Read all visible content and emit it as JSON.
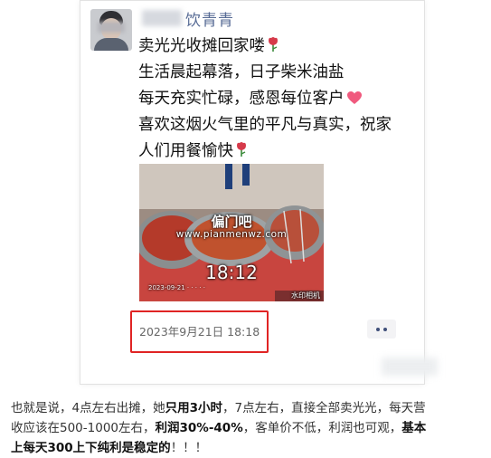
{
  "post": {
    "author_name": "饮青青",
    "lines": [
      "卖光光收摊回家喽",
      "生活晨起幕落，日子柴米油盐",
      "每天充实忙碌，感恩每位客户",
      "喜欢这烟火气里的平凡与真实，祝家",
      "人们用餐愉快"
    ],
    "emoji_icons": [
      "rose-icon",
      "heart-icon",
      "rose-icon"
    ],
    "photo": {
      "watermark_site_cn": "偏门吧",
      "watermark_url": "www.pianmenwz.com",
      "time_overlay": "18:12",
      "camera_label": "水印相机",
      "caption_small": "2023-09-21  ·  ·  ·  ·  ·"
    },
    "timestamp": "2023年9月21日 18:18",
    "more_button_icon": "more-dots-icon"
  },
  "article": {
    "line1_a": "也就是说，4点左右出摊，她",
    "line1_b": "只用3小时",
    "line1_c": "，7点左右，直接全部卖光光，每天营",
    "line2_a": "收应该在500-1000左右，",
    "line2_b": "利润30%-40%",
    "line2_c": "，客单价不低，利润也可观，",
    "line2_d": "基本",
    "line3_a": "上每天300上下纯利是稳定的",
    "line3_b": "！！！"
  },
  "colors": {
    "name_link": "#576b95",
    "highlight_box": "#e02424",
    "rose": "#d63a4a",
    "heart": "#f05a7e"
  }
}
